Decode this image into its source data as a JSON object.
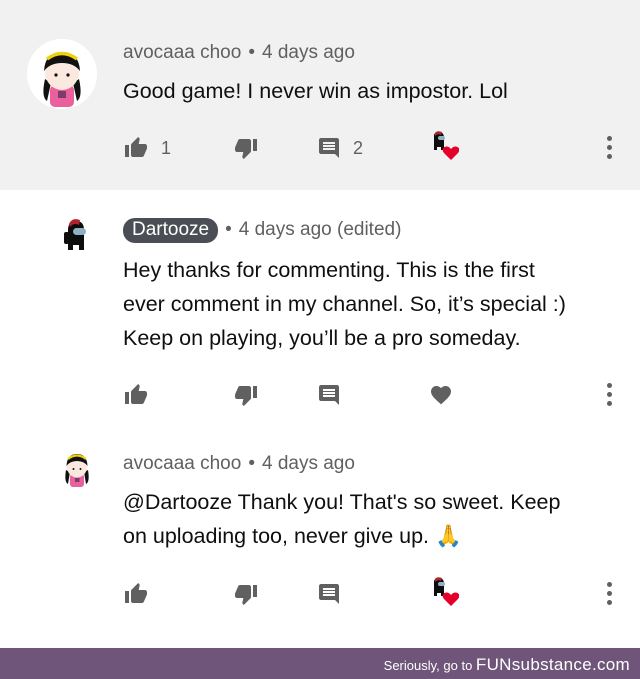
{
  "comments": [
    {
      "author": "avocaaa choo",
      "separator": "•",
      "time": "4 days ago",
      "text": "Good game! I never win as impostor. Lol",
      "likes": "1",
      "replies": "2"
    },
    {
      "author": "Dartooze",
      "separator": "•",
      "time": "4 days ago (edited)",
      "lines": [
        "Hey thanks for commenting. This is the first",
        "ever comment in my channel. So, it’s special :)",
        "Keep on playing, you’ll be a pro someday."
      ]
    },
    {
      "author": "avocaaa choo",
      "separator": "•",
      "time": "4 days ago",
      "lines": [
        "@Dartooze Thank you! That's so sweet. Keep",
        "on uploading too, never give up. 🙏"
      ]
    }
  ],
  "footer": {
    "prefix": "Seriously, go to",
    "brand": "FUNsubstance.com"
  },
  "icons": {
    "like": "thumbs-up-icon",
    "dislike": "thumbs-down-icon",
    "reply": "comment-icon",
    "heart": "heart-icon",
    "more": "kebab-icon"
  },
  "colors": {
    "highlight_bg": "#f1f1f1",
    "icon": "#606060",
    "heart": "#e4002b",
    "footer_bg": "#6f5579"
  }
}
